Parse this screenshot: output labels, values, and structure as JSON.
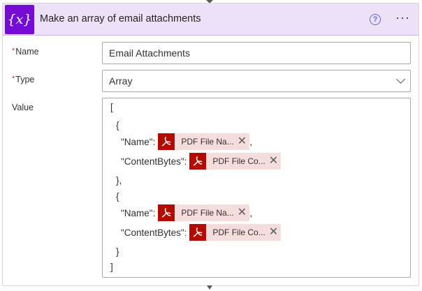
{
  "header": {
    "icon_text": "{x}",
    "title": "Make an array of email attachments",
    "help_icon_text": "?",
    "more_icon_text": "···",
    "accent_color": "#770bd6",
    "header_bg": "#ece1f7"
  },
  "fields": {
    "required_mark": "*",
    "name_label": "Name",
    "name_value": "Email Attachments",
    "type_label": "Type",
    "type_value": "Array",
    "value_label": "Value"
  },
  "value_code": {
    "open_bracket": "[",
    "open_brace": "{",
    "close_brace_comma": "},",
    "close_brace": "}",
    "close_bracket": "]",
    "name_key": "\"Name\":",
    "content_key": "\"ContentBytes\":",
    "comma": ",",
    "token_name_label": "PDF File Na...",
    "token_content_label": "PDF File Co...",
    "token_close": "✕",
    "token_icon": "pdf-icon",
    "token_color": "#b30b00"
  }
}
